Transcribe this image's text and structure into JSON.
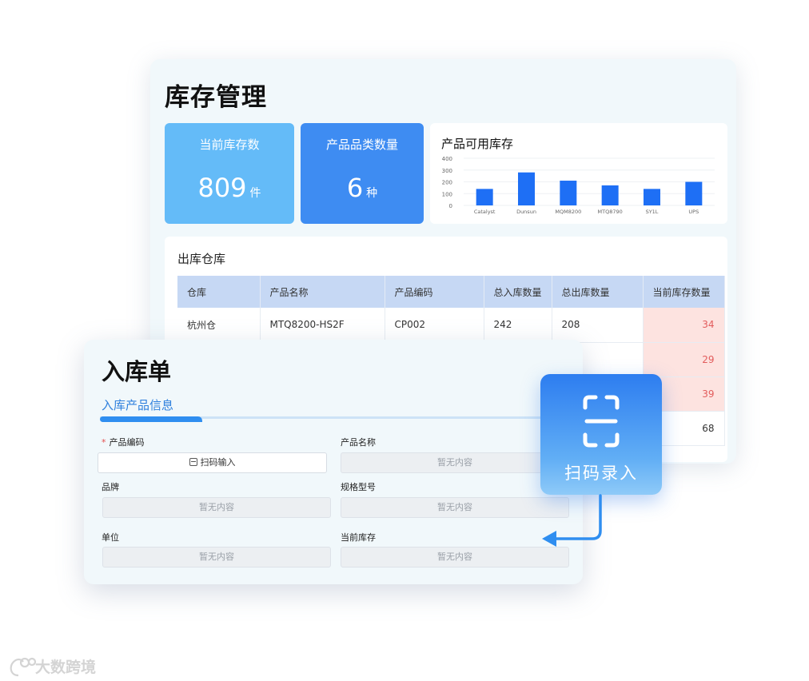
{
  "inventory": {
    "title": "库存管理",
    "stats": [
      {
        "label": "当前库存数",
        "value": "809",
        "unit": "件",
        "color": "#64bbf8"
      },
      {
        "label": "产品品类数量",
        "value": "6",
        "unit": "种",
        "color": "#3e8cf2"
      }
    ]
  },
  "chart_data": {
    "type": "bar",
    "title": "产品可用库存",
    "categories": [
      "Catalyst",
      "Dunsun",
      "MQM8200",
      "MTQ8790",
      "SY1L",
      "UPS"
    ],
    "values": [
      140,
      280,
      210,
      170,
      140,
      200
    ],
    "ylim": [
      0,
      400
    ],
    "yticks": [
      0,
      100,
      200,
      300,
      400
    ],
    "grid": true,
    "bar_color": "#1e6ff5"
  },
  "outbound": {
    "title": "出库仓库",
    "columns": [
      "仓库",
      "产品名称",
      "产品编码",
      "总入库数量",
      "总出库数量",
      "当前库存数量"
    ],
    "rows": [
      [
        "杭州仓",
        "MTQ8200-HS2F",
        "CP002",
        "242",
        "208",
        "34"
      ]
    ],
    "partial_stock_values": [
      "29",
      "39",
      "68"
    ],
    "low_stock_color": "#e25c5c"
  },
  "form": {
    "title": "入库单",
    "tab": "入库产品信息",
    "fields": {
      "product_code": {
        "label": "产品编码",
        "required_mark": "*",
        "button": "扫码输入"
      },
      "product_name": {
        "label": "产品名称",
        "placeholder": "暂无内容"
      },
      "brand": {
        "label": "品牌",
        "placeholder": "暂无内容"
      },
      "spec": {
        "label": "规格型号",
        "placeholder": "暂无内容"
      },
      "unit": {
        "label": "单位",
        "placeholder": "暂无内容"
      },
      "current_stock": {
        "label": "当前库存",
        "placeholder": "暂无内容"
      }
    }
  },
  "scan_badge": {
    "label": "扫码录入",
    "icon": "scan-icon"
  },
  "watermark": {
    "text": "大数跨境"
  }
}
